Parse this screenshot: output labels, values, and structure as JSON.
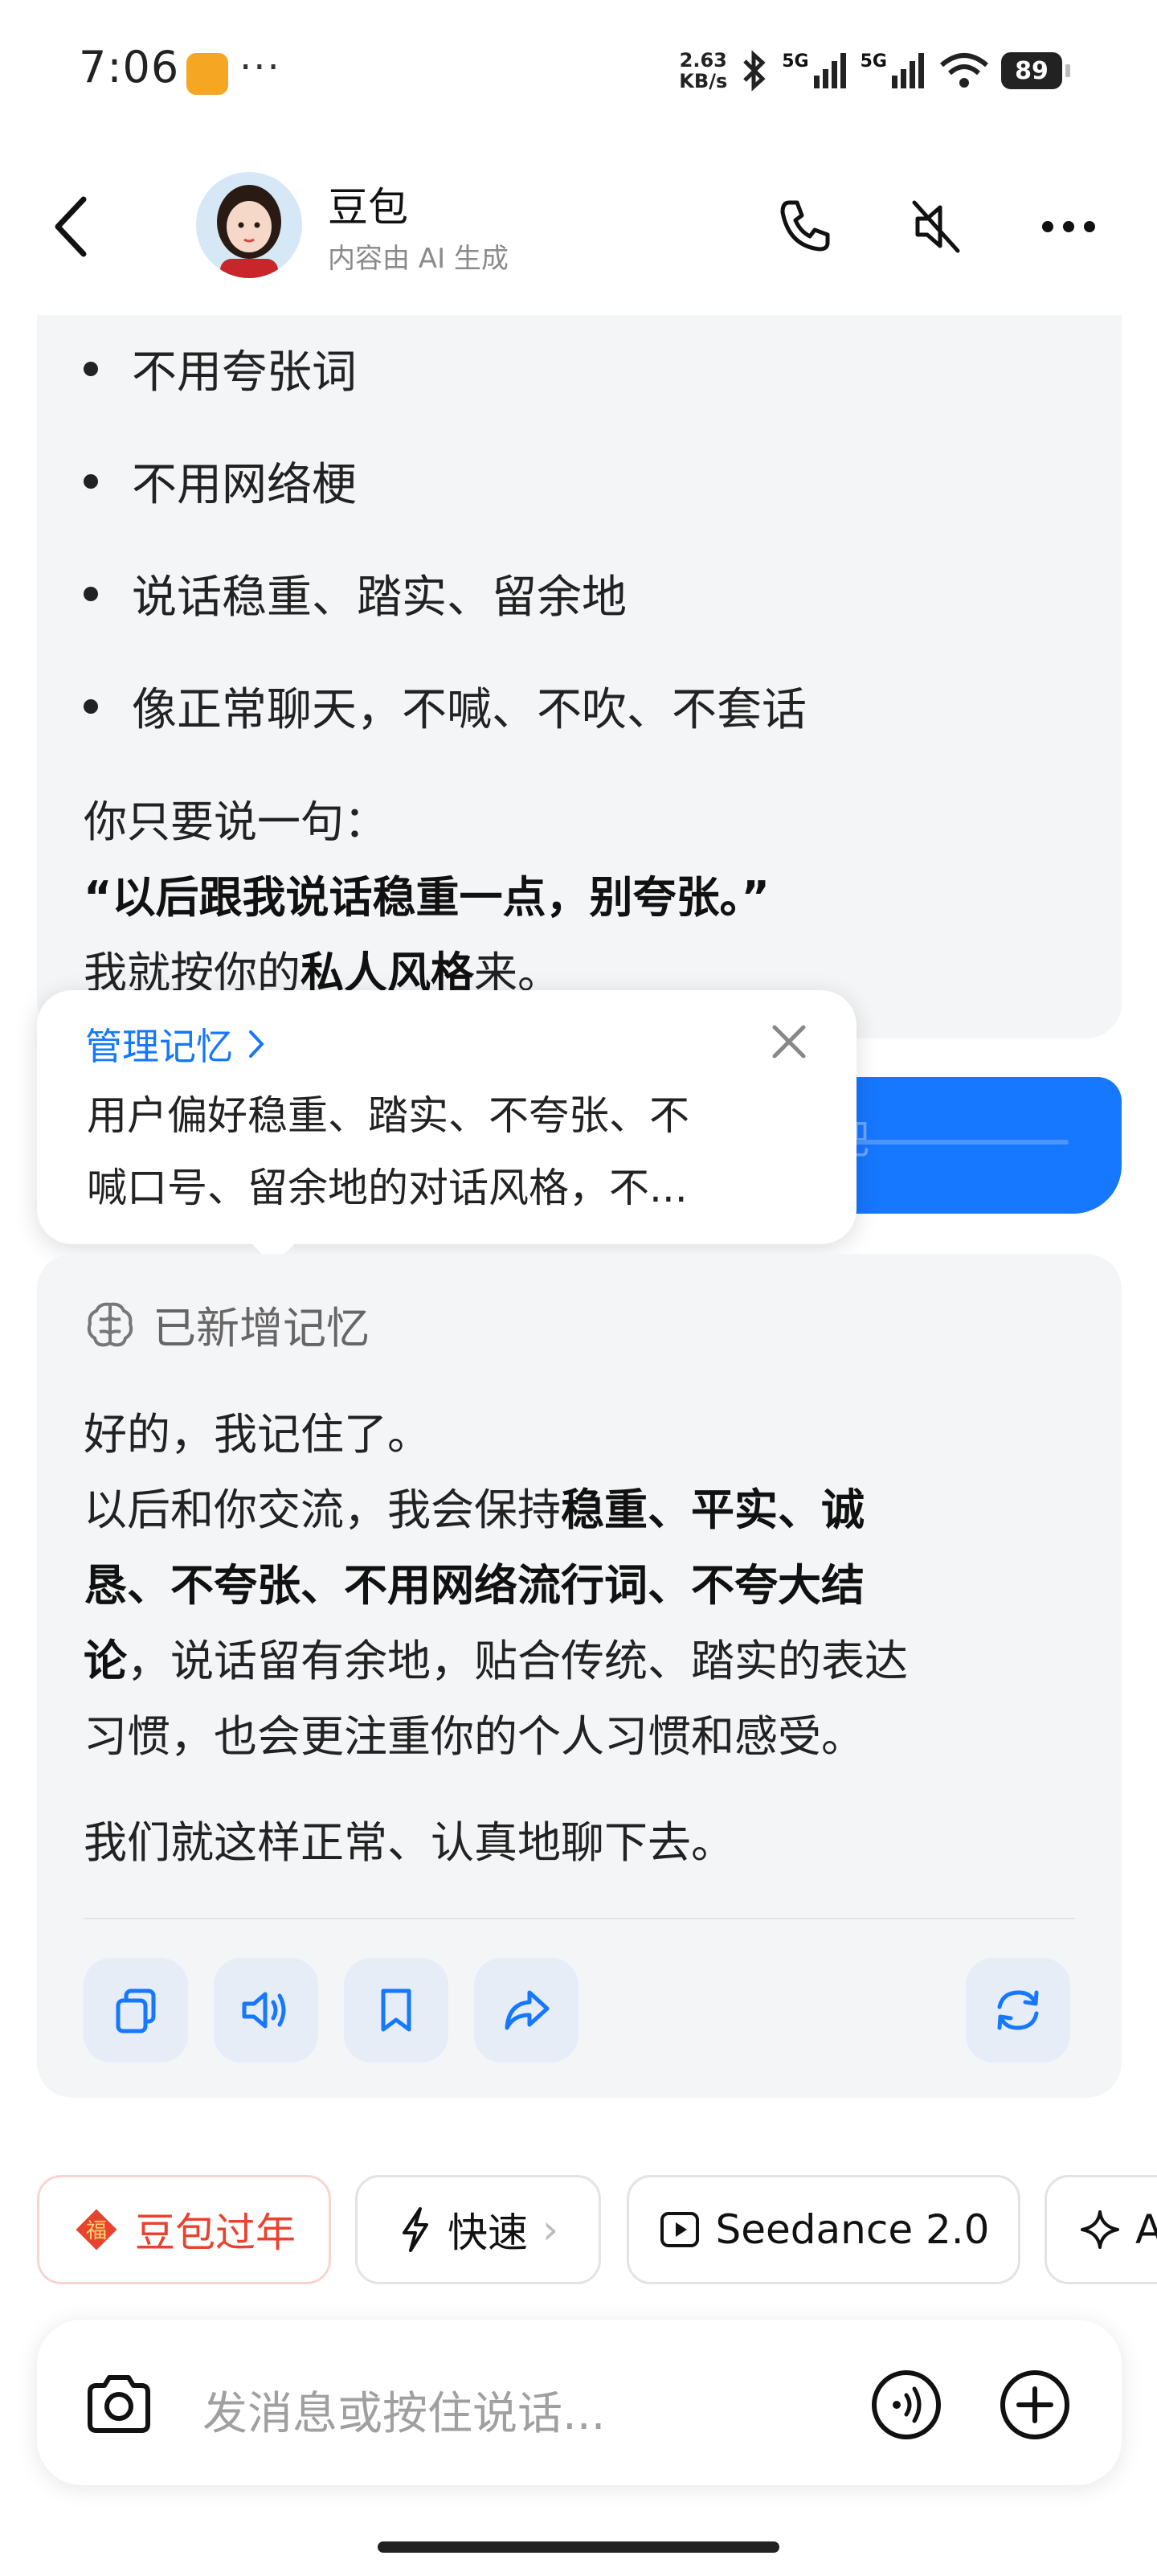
{
  "status_bar": {
    "time": "7:06",
    "net_speed_value": "2.63",
    "net_speed_unit": "KB/s",
    "signal1": "5G",
    "signal2": "5G",
    "battery": "89",
    "more": "···"
  },
  "header": {
    "bot_name": "豆包",
    "subtitle": "内容由 AI 生成"
  },
  "card1": {
    "bullets": [
      "不用夸张词",
      "不用网络梗",
      "说话稳重、踏实、留余地",
      "像正常聊天，不喊、不吹、不套话"
    ],
    "line1": "你只要说一句：",
    "quote": "“以后跟我说话稳重一点，别夸张。”",
    "line3_pre": "我就按你的",
    "line3_bold": "私人风格",
    "line3_post": "来。"
  },
  "user_bubble": {
    "visible_fragment": "吧"
  },
  "memory_popup": {
    "manage_label": "管理记忆",
    "text_line1": "用户偏好稳重、踏实、不夸张、不",
    "text_line2": "喊口号、留余地的对话风格，不..."
  },
  "card2": {
    "memory_added_label": "已新增记忆",
    "line1": "好的，我记住了。",
    "line2_pre": "以后和你交流，我会保持",
    "line2_bold": "稳重、平实、诚",
    "line3_bold": "恳、不夸张、不用网络流行词、不夸大结",
    "line4_bold": "论",
    "line4_post": "，说话留有余地，贴合传统、踏实的表达",
    "line5": "习惯，也会更注重你的个人习惯和感受。",
    "line6": "我们就这样正常、认真地聊下去。"
  },
  "chips": [
    {
      "label": "豆包过年",
      "icon": "fu-icon"
    },
    {
      "label": "快速",
      "icon": "lightning-icon",
      "chevron": "›"
    },
    {
      "label": "Seedance 2.0",
      "icon": "video-play-icon"
    },
    {
      "label": "A",
      "icon": "sparkle-icon"
    }
  ],
  "input": {
    "placeholder": "发消息或按住说话..."
  },
  "colors": {
    "accent": "#1677ff",
    "card_bg": "#f4f5f7",
    "chip_red": "#e8432f"
  }
}
